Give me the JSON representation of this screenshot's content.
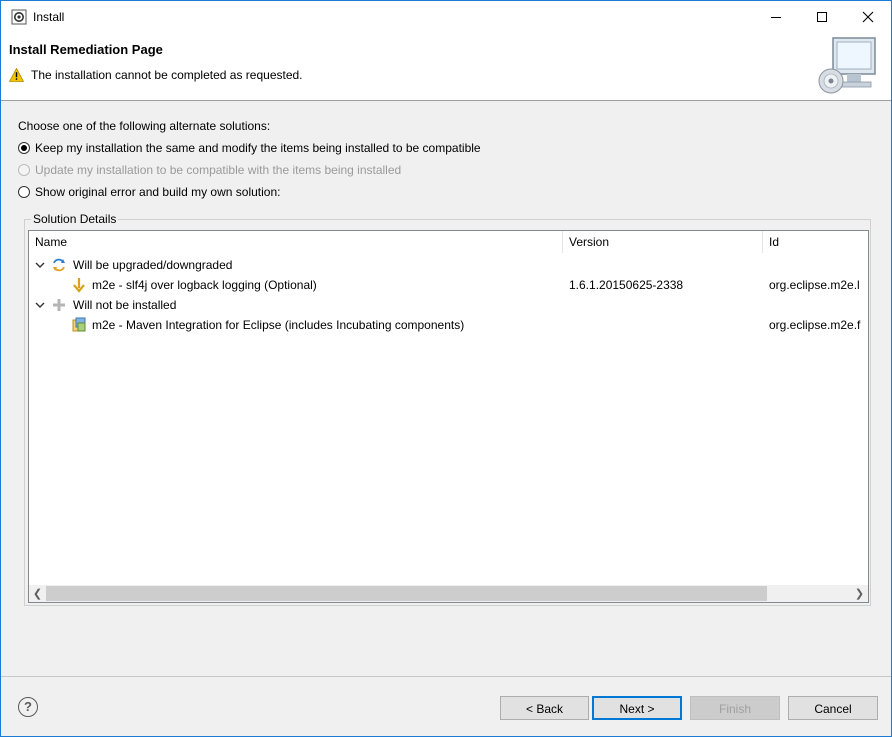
{
  "window": {
    "title": "Install"
  },
  "header": {
    "page_title": "Install Remediation Page",
    "message": "The installation cannot be completed as requested."
  },
  "choices": {
    "label": "Choose one of the following alternate solutions:",
    "options": [
      {
        "label": "Keep my installation the same and modify the items being installed to be compatible",
        "selected": true,
        "enabled": true
      },
      {
        "label": "Update my installation to be compatible with the items being installed",
        "selected": false,
        "enabled": false
      },
      {
        "label": "Show original error and build my own solution:",
        "selected": false,
        "enabled": true
      }
    ]
  },
  "details": {
    "group_label": "Solution Details",
    "columns": [
      "Name",
      "Version",
      "Id"
    ],
    "rows": [
      {
        "name": "Will be upgraded/downgraded",
        "version": "",
        "id": "",
        "icon": "upgrade-icon",
        "expanded": true,
        "level": 0
      },
      {
        "name": "m2e - slf4j over logback logging (Optional)",
        "version": "1.6.1.20150625-2338",
        "id": "org.eclipse.m2e.l",
        "icon": "downgrade-arrow-icon",
        "level": 1
      },
      {
        "name": "Will not be installed",
        "version": "",
        "id": "",
        "icon": "not-installed-icon",
        "expanded": true,
        "level": 0
      },
      {
        "name": "m2e - Maven Integration for Eclipse (includes Incubating components)",
        "version": "",
        "id": "org.eclipse.m2e.f",
        "icon": "feature-icon",
        "level": 1
      }
    ]
  },
  "buttons": {
    "back": "< Back",
    "next": "Next >",
    "finish": "Finish",
    "cancel": "Cancel"
  },
  "colors": {
    "accent": "#0078d7",
    "warning": "#f5c400",
    "window_border": "#1c7ad4"
  }
}
